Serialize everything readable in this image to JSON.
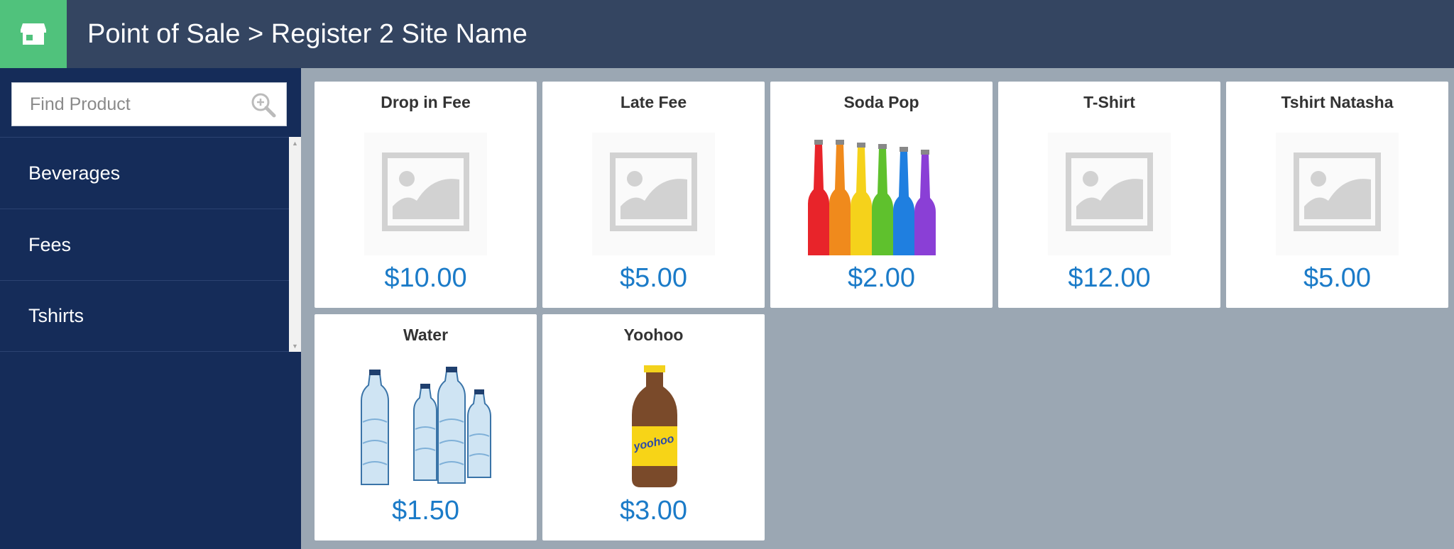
{
  "header": {
    "title": "Point of Sale > Register 2 Site Name",
    "store_icon": "store-icon"
  },
  "search": {
    "placeholder": "Find Product",
    "value": "",
    "icon": "zoom-in-icon"
  },
  "categories": [
    {
      "label": "Beverages"
    },
    {
      "label": "Fees"
    },
    {
      "label": "Tshirts"
    }
  ],
  "products": [
    {
      "name": "Drop in Fee",
      "price": "$10.00",
      "image": "placeholder-image-icon"
    },
    {
      "name": "Late Fee",
      "price": "$5.00",
      "image": "placeholder-image-icon"
    },
    {
      "name": "Soda Pop",
      "price": "$2.00",
      "image": "soda-bottles-image"
    },
    {
      "name": "T-Shirt",
      "price": "$12.00",
      "image": "placeholder-image-icon"
    },
    {
      "name": "Tshirt Natasha",
      "price": "$5.00",
      "image": "placeholder-image-icon"
    },
    {
      "name": "Water",
      "price": "$1.50",
      "image": "water-bottles-image"
    },
    {
      "name": "Yoohoo",
      "price": "$3.00",
      "image": "yoohoo-bottle-image"
    }
  ],
  "colors": {
    "header_bg": "#344561",
    "store_button_bg": "#50c27c",
    "sidebar_bg": "#152c59",
    "content_bg": "#9ba7b3",
    "price_color": "#1b7bc8"
  }
}
